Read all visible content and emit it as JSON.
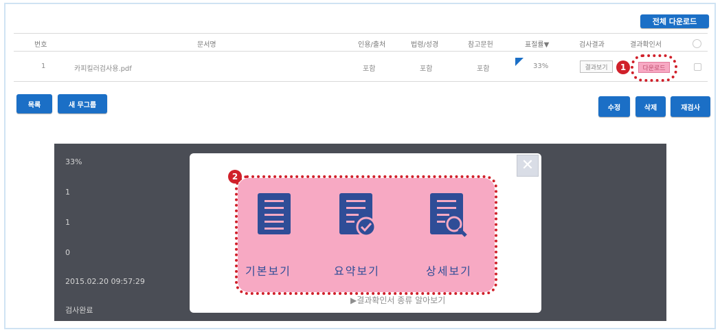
{
  "toolbar": {
    "download_all_label": "전체 다운로드"
  },
  "table": {
    "headers": {
      "no": "번호",
      "doc_name": "문서명",
      "citation": "인용/출처",
      "law": "법령/성경",
      "reference": "참고문헌",
      "plagiarism": "표절률▼",
      "result": "검사결과",
      "cert": "결과확인서"
    },
    "row": {
      "no": "1",
      "doc_name": "카피킬러검사용.pdf",
      "citation": "포함",
      "law": "포함",
      "reference": "포함",
      "plagiarism": "33%",
      "result_button": "결과보기",
      "cert_button": "다운로드"
    }
  },
  "actions": {
    "list": "목록",
    "new_group": "새 무그룹",
    "edit": "수정",
    "delete": "삭제",
    "recheck": "재검사"
  },
  "badges": {
    "one": "1",
    "two": "2"
  },
  "details": [
    "33%",
    "1",
    "1",
    "0",
    "2015.02.20 09:57:29",
    "검사완료"
  ],
  "modal": {
    "close_glyph": "✕",
    "options": [
      "기본보기",
      "요약보기",
      "상세보기"
    ],
    "footnote": "▶결과확인서 종류 알아보기"
  },
  "colors": {
    "primary_blue": "#1b6fc6",
    "highlight_red": "#d0202a",
    "highlight_pink": "#f7a9c3",
    "icon_navy": "#2f4d97",
    "dark_panel": "#4a4d55"
  },
  "icons": [
    "close-icon",
    "document-icon",
    "document-check-icon",
    "document-search-icon",
    "sort-down-icon",
    "play-icon"
  ]
}
